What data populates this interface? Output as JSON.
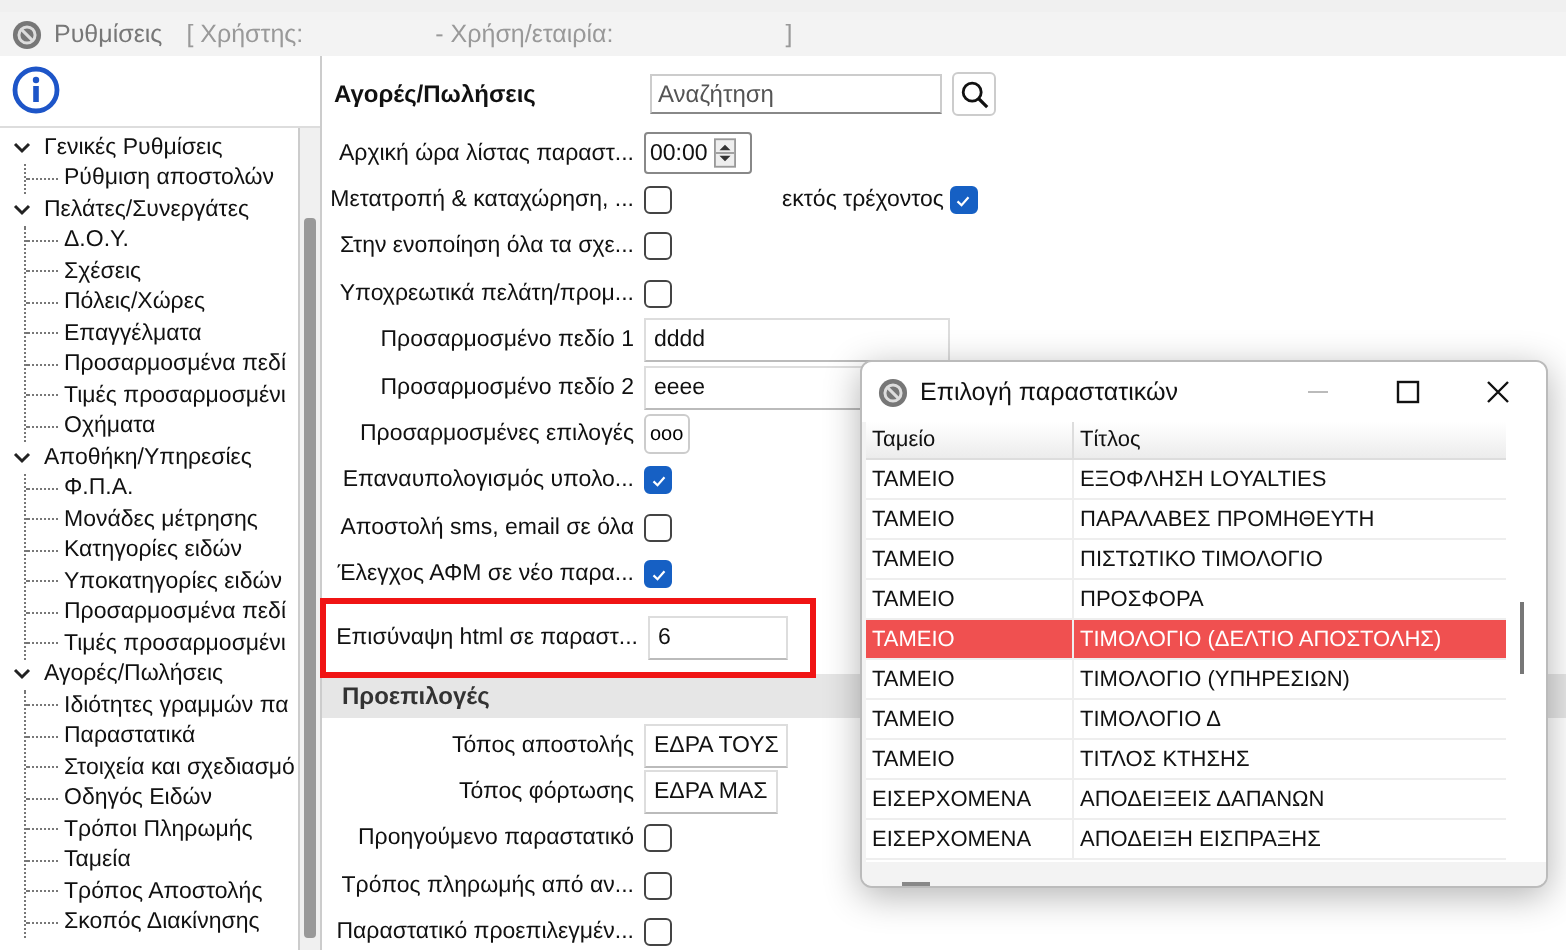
{
  "window": {
    "title": "Ρυθμίσεις",
    "context": [
      "[ Χρήστης:",
      "- Χρήση/εταιρία:",
      "]"
    ]
  },
  "tree": [
    {
      "label": "Γενικές Ρυθμίσεις",
      "expanded": true,
      "children": [
        {
          "label": "Ρύθμιση αποστολών"
        }
      ]
    },
    {
      "label": "Πελάτες/Συνεργάτες",
      "expanded": true,
      "children": [
        {
          "label": "Δ.Ο.Υ."
        },
        {
          "label": "Σχέσεις"
        },
        {
          "label": "Πόλεις/Χώρες"
        },
        {
          "label": "Επαγγέλματα"
        },
        {
          "label": "Προσαρμοσμένα πεδί"
        },
        {
          "label": "Τιμές προσαρμοσμένι"
        },
        {
          "label": "Οχήματα"
        }
      ]
    },
    {
      "label": "Αποθήκη/Υπηρεσίες",
      "expanded": true,
      "children": [
        {
          "label": "Φ.Π.Α."
        },
        {
          "label": "Μονάδες μέτρησης"
        },
        {
          "label": "Κατηγορίες ειδών"
        },
        {
          "label": "Υποκατηγορίες ειδών"
        },
        {
          "label": "Προσαρμοσμένα πεδί"
        },
        {
          "label": "Τιμές προσαρμοσμένι"
        }
      ]
    },
    {
      "label": "Αγορές/Πωλήσεις",
      "expanded": true,
      "children": [
        {
          "label": "Ιδιότητες γραμμών πα"
        },
        {
          "label": "Παραστατικά"
        },
        {
          "label": "Στοιχεία και σχεδιασμό"
        },
        {
          "label": "Οδηγός Ειδών"
        },
        {
          "label": "Τρόποι Πληρωμής"
        },
        {
          "label": "Ταμεία"
        },
        {
          "label": "Τρόπος Αποστολής"
        },
        {
          "label": "Σκοπός Διακίνησης"
        }
      ]
    }
  ],
  "panel": {
    "heading": "Αγορές/Πωλήσεις",
    "search": {
      "placeholder": "Αναζήτηση"
    }
  },
  "settings": [
    {
      "kind": "time",
      "label": "Αρχική ώρα λίστας παραστ...",
      "value": "00:00"
    },
    {
      "kind": "checkbox",
      "label": "Μετατροπή & καταχώρηση, ...",
      "checked": false,
      "extra": {
        "label": "εκτός τρέχοντος",
        "checked": true
      }
    },
    {
      "kind": "checkbox",
      "label": "Στην ενοποίηση όλα τα σχε...",
      "checked": false
    },
    {
      "kind": "checkbox",
      "label": "Υποχρεωτικά πελάτη/προμ...",
      "checked": false
    },
    {
      "kind": "text",
      "label": "Προσαρμοσμένο πεδίο 1",
      "value": "dddd"
    },
    {
      "kind": "text",
      "label": "Προσαρμοσμένο πεδίο 2",
      "value": "eeee"
    },
    {
      "kind": "button",
      "label": "Προσαρμοσμένες επιλογές",
      "value": "ooo"
    },
    {
      "kind": "checkbox",
      "label": "Επαναυπολογισμός υπολο...",
      "checked": true
    },
    {
      "kind": "checkbox",
      "label": "Αποστολή sms, email σε όλα",
      "checked": false
    },
    {
      "kind": "checkbox",
      "label": "Έλεγχος ΑΦΜ σε νέο παρα...",
      "checked": true
    },
    {
      "kind": "number",
      "label": "Επισύναψη html σε παραστ...",
      "value": "6",
      "highlighted": true
    }
  ],
  "defaults": {
    "heading": "Προεπιλογές",
    "rows": [
      {
        "kind": "text",
        "label": "Τόπος αποστολής",
        "value": "ΕΔΡΑ ΤΟΥΣ"
      },
      {
        "kind": "text",
        "label": "Τόπος φόρτωσης",
        "value": "ΕΔΡΑ ΜΑΣ"
      },
      {
        "kind": "checkbox",
        "label": "Προηγούμενο παραστατικό",
        "checked": false
      },
      {
        "kind": "checkbox",
        "label": "Τρόπος πληρωμής από αν...",
        "checked": false
      },
      {
        "kind": "checkbox",
        "label": "Παραστατικό προεπιλεγμέν...",
        "checked": false
      }
    ]
  },
  "dialog": {
    "title": "Επιλογή παραστατικών",
    "table": {
      "columns": [
        "Ταμείο",
        "Τίτλος"
      ],
      "rows": [
        {
          "cells": [
            "ΤΑΜΕΙΟ",
            "ΕΞΟΦΛΗΣΗ LOYALTIES"
          ],
          "selected": false
        },
        {
          "cells": [
            "ΤΑΜΕΙΟ",
            "ΠΑΡΑΛΑΒΕΣ ΠΡΟΜΗΘΕΥΤΗ"
          ],
          "selected": false
        },
        {
          "cells": [
            "ΤΑΜΕΙΟ",
            "ΠΙΣΤΩΤΙΚΟ ΤΙΜΟΛΟΓΙΟ"
          ],
          "selected": false
        },
        {
          "cells": [
            "ΤΑΜΕΙΟ",
            "ΠΡΟΣΦΟΡΑ"
          ],
          "selected": false
        },
        {
          "cells": [
            "ΤΑΜΕΙΟ",
            "ΤΙΜΟΛΟΓΙΟ (ΔΕΛΤΙΟ ΑΠΟΣΤΟΛΗΣ)"
          ],
          "selected": true
        },
        {
          "cells": [
            "ΤΑΜΕΙΟ",
            "ΤΙΜΟΛΟΓΙΟ (ΥΠΗΡΕΣΙΩΝ)"
          ],
          "selected": false
        },
        {
          "cells": [
            "ΤΑΜΕΙΟ",
            "ΤΙΜΟΛΟΓΙΟ Δ"
          ],
          "selected": false
        },
        {
          "cells": [
            "ΤΑΜΕΙΟ",
            "ΤΙΤΛΟΣ ΚΤΗΣΗΣ"
          ],
          "selected": false
        },
        {
          "cells": [
            "ΕΙΣΕΡΧΟΜΕΝΑ",
            "ΑΠΟΔΕΙΞΕΙΣ ΔΑΠΑΝΩΝ"
          ],
          "selected": false
        },
        {
          "cells": [
            "ΕΙΣΕΡΧΟΜΕΝΑ",
            "ΑΠΟΔΕΙΞΗ ΕΙΣΠΡΑΞΗΣ"
          ],
          "selected": false
        }
      ]
    }
  }
}
